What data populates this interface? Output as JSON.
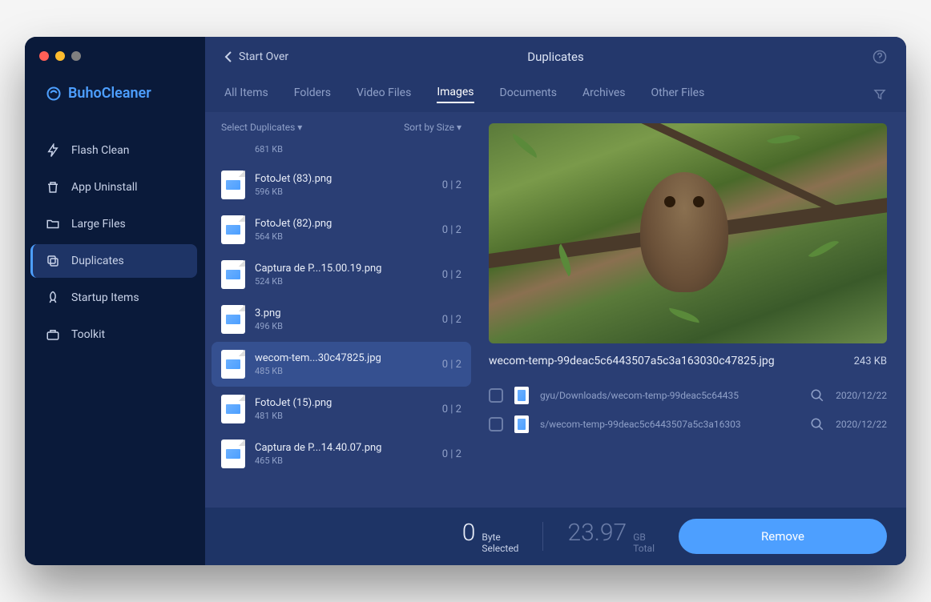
{
  "app": {
    "name": "BuhoCleaner"
  },
  "header": {
    "back_label": "Start Over",
    "title": "Duplicates"
  },
  "sidebar": {
    "items": [
      {
        "label": "Flash Clean"
      },
      {
        "label": "App Uninstall"
      },
      {
        "label": "Large Files"
      },
      {
        "label": "Duplicates"
      },
      {
        "label": "Startup Items"
      },
      {
        "label": "Toolkit"
      }
    ]
  },
  "tabs": [
    "All Items",
    "Folders",
    "Video Files",
    "Images",
    "Documents",
    "Archives",
    "Other Files"
  ],
  "list": {
    "select_label": "Select Duplicates",
    "sort_label": "Sort by Size",
    "items": [
      {
        "name": "",
        "size": "681 KB",
        "count": ""
      },
      {
        "name": "FotoJet (83).png",
        "size": "596 KB",
        "count": "0 | 2"
      },
      {
        "name": "FotoJet (82).png",
        "size": "564 KB",
        "count": "0 | 2"
      },
      {
        "name": "Captura de P...15.00.19.png",
        "size": "524 KB",
        "count": "0 | 2"
      },
      {
        "name": "3.png",
        "size": "496 KB",
        "count": "0 | 2"
      },
      {
        "name": "wecom-tem...30c47825.jpg",
        "size": "485 KB",
        "count": "0 | 2"
      },
      {
        "name": "FotoJet (15).png",
        "size": "481 KB",
        "count": "0 | 2"
      },
      {
        "name": "Captura de P...14.40.07.png",
        "size": "465 KB",
        "count": "0 | 2"
      }
    ]
  },
  "preview": {
    "filename": "wecom-temp-99deac5c6443507a5c3a163030c47825.jpg",
    "size": "243 KB",
    "duplicates": [
      {
        "path": "gyu/Downloads/wecom-temp-99deac5c64435",
        "date": "2020/12/22"
      },
      {
        "path": "s/wecom-temp-99deac5c6443507a5c3a16303",
        "date": "2020/12/22"
      }
    ]
  },
  "footer": {
    "selected_num": "0",
    "selected_label_1": "Byte",
    "selected_label_2": "Selected",
    "total_num": "23.97",
    "total_label_1": "GB",
    "total_label_2": "Total",
    "remove_label": "Remove"
  }
}
